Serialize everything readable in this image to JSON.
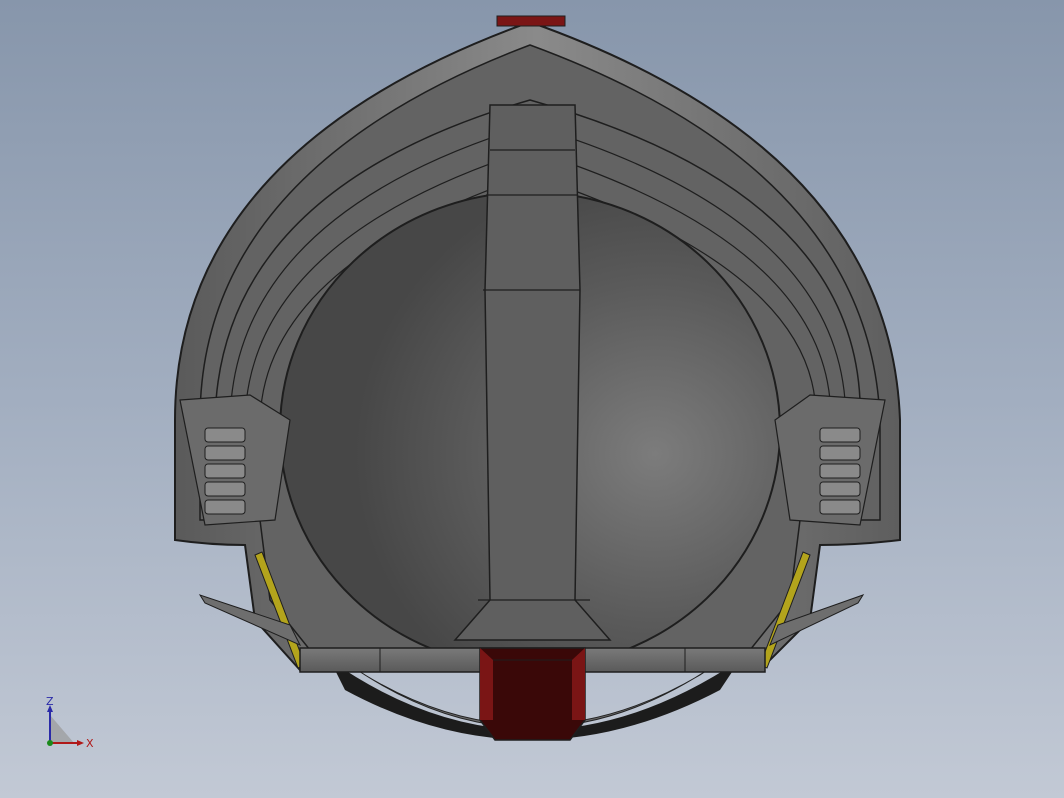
{
  "viewport": {
    "background_top": "#8796ab",
    "background_bottom": "#c2c9d5"
  },
  "model": {
    "shell_color": "#6e6e6e",
    "inner_color": "#5a5a5a",
    "accent_red": "#7a1515",
    "accent_yellow": "#b3a41c",
    "edge_color": "#1e1e1e"
  },
  "triad": {
    "z_label": "Z",
    "x_label": "X",
    "z_color": "#2a2aa8",
    "x_color": "#b01818"
  }
}
